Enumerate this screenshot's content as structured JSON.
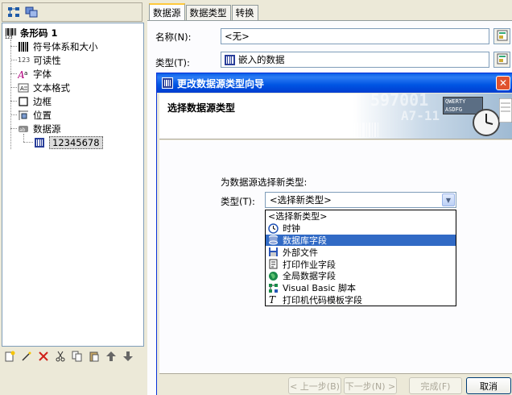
{
  "colors": {
    "titlebar": "#0054e3",
    "selection": "#316ac5",
    "window_bg": "#ece9d8",
    "close_button": "#e0522e"
  },
  "tree": {
    "root_label": "条形码 1",
    "items": [
      {
        "label": "符号体系和大小",
        "icon": "barcode-symbology-icon"
      },
      {
        "label": "可读性",
        "icon": "readability-icon"
      },
      {
        "label": "字体",
        "icon": "font-icon"
      },
      {
        "label": "文本格式",
        "icon": "text-format-icon"
      },
      {
        "label": "边框",
        "icon": "border-icon"
      },
      {
        "label": "位置",
        "icon": "position-icon"
      },
      {
        "label": "数据源",
        "icon": "datasource-icon"
      }
    ],
    "child_label": "12345678",
    "readability_icon_text": "123"
  },
  "tabs": [
    {
      "label": "数据源"
    },
    {
      "label": "数据类型"
    },
    {
      "label": "转换"
    }
  ],
  "form": {
    "name_label": "名称(N):",
    "name_value": "<无>",
    "type_label": "类型(T):",
    "type_value": "嵌入的数据"
  },
  "wizard": {
    "title": "更改数据源类型向导",
    "header_title": "选择数据源类型",
    "watermark_top": "597001",
    "watermark_mid": "A7-11",
    "keyboard_row1": "QWERTY",
    "keyboard_row2": "ASDFG",
    "prompt": "为数据源选择新类型:",
    "type_label": "类型(T):",
    "selected_value": "<选择新类型>",
    "options": [
      {
        "label": "<选择新类型>",
        "icon": ""
      },
      {
        "label": "时钟",
        "icon": "clock-icon"
      },
      {
        "label": "数据库字段",
        "icon": "database-icon",
        "selected": true
      },
      {
        "label": "外部文件",
        "icon": "disk-icon"
      },
      {
        "label": "打印作业字段",
        "icon": "print-job-icon"
      },
      {
        "label": "全局数据字段",
        "icon": "globe-icon"
      },
      {
        "label": "Visual Basic 脚本",
        "icon": "vb-script-icon"
      },
      {
        "label": "打印机代码模板字段",
        "icon": "printer-code-icon"
      }
    ],
    "buttons": {
      "back": "< 上一步(B)",
      "next": "下一步(N) >",
      "finish": "完成(F)",
      "cancel": "取消"
    }
  }
}
